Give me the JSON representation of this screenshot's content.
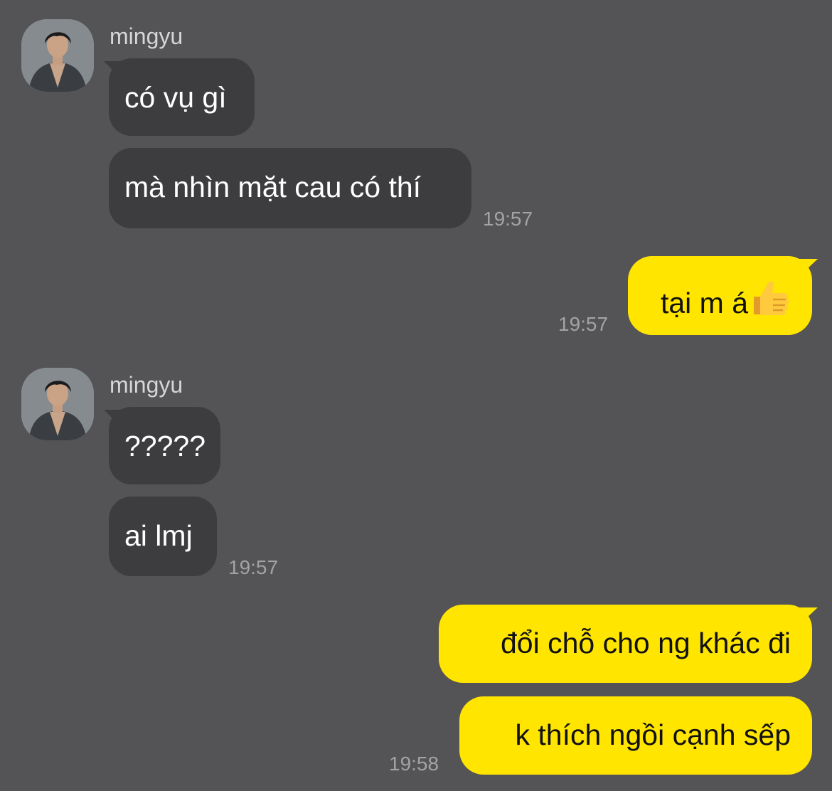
{
  "groups": [
    {
      "sender": "mingyu",
      "avatar_icon": "profile-photo",
      "messages": [
        "có vụ gì",
        "mà nhìn mặt cau có thí"
      ],
      "time": "19:57"
    },
    {
      "outgoing": true,
      "messages": [
        "tại m á"
      ],
      "emoji_icon": "thumbs-up-emoji",
      "time": "19:57"
    },
    {
      "sender": "mingyu",
      "avatar_icon": "profile-photo",
      "messages": [
        "?????",
        "ai lmj"
      ],
      "time": "19:57"
    },
    {
      "outgoing": true,
      "messages": [
        "đổi chỗ cho ng khác đi",
        "k thích ngồi cạnh sếp"
      ],
      "time": "19:58"
    }
  ],
  "colors": {
    "background": "#545355",
    "incoming_bubble": "#3d3c3f",
    "outgoing_bubble": "#ffe500",
    "timestamp": "#a3a2a5"
  }
}
